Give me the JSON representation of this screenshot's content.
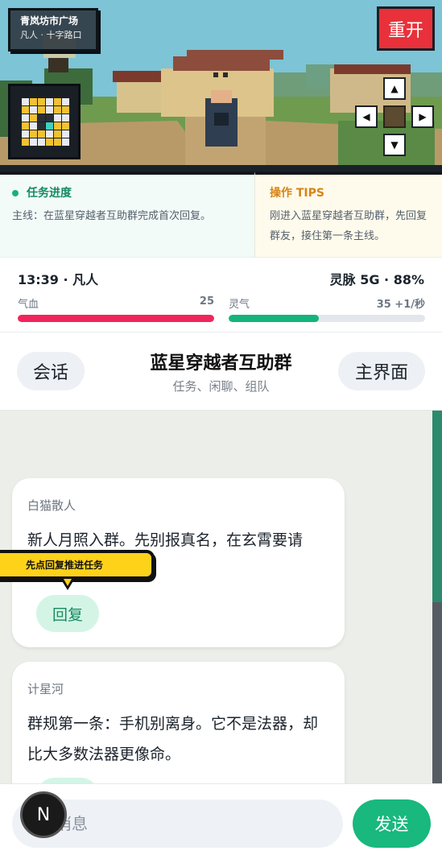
{
  "scene": {
    "location_title": "青岚坊市广场",
    "location_sub": "凡人 · 十字路口",
    "restart_label": "重开",
    "dpad": {
      "up": "▲",
      "down": "▼",
      "left": "◀",
      "right": "▶"
    }
  },
  "quest": {
    "heading": "任务进度",
    "body": "主线：在蓝星穿越者互助群完成首次回复。"
  },
  "tips": {
    "heading": "操作 TIPS",
    "body": "刚进入蓝星穿越者互助群，先回复群友，接住第一条主线。"
  },
  "stats": {
    "time_rank": "13:39 · 凡人",
    "signal": "灵脉 5G · 88%",
    "hp": {
      "label": "气血",
      "value_text": "25",
      "fill_fraction": 1.0,
      "color": "#f0255c"
    },
    "qi": {
      "label": "灵气",
      "value_text": "35 +1/秒",
      "fill_fraction": 0.46,
      "color": "#14b47c"
    }
  },
  "chat": {
    "back_label": "会话",
    "title": "蓝星穿越者互助群",
    "subtitle": "任务、闲聊、组队",
    "home_label": "主界面"
  },
  "messages": [
    {
      "sender": "白猫散人",
      "text": "新人月照入群。先别报真名，在玄霄要请用。",
      "reply_label": "回复"
    },
    {
      "sender": "计星河",
      "text": "群规第一条：手机别离身。它不是法器，却比大多数法器更像命。",
      "reply_label": ""
    }
  ],
  "hint": {
    "text": "先点回复推进任务"
  },
  "input": {
    "placeholder": "消息",
    "send_label": "发送"
  },
  "badge": {
    "label": "N"
  }
}
